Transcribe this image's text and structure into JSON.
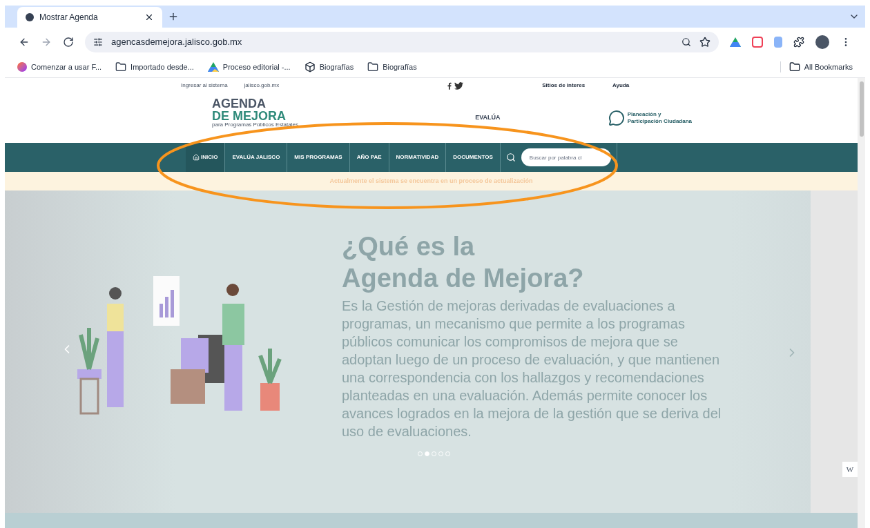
{
  "browser": {
    "tabs": [
      {
        "title": "Mostrar Agenda",
        "selected": true
      }
    ],
    "url": "agencasdemejora.jalisco.gob.mx",
    "bookmarks": [
      {
        "label": "Comenzar a usar F...",
        "kind": "firefox"
      },
      {
        "label": "Importado desde...",
        "kind": "folder"
      },
      {
        "label": "Proceso editorial -...",
        "kind": "drive"
      },
      {
        "label": "Biografías",
        "kind": "cube"
      },
      {
        "label": "Biografías",
        "kind": "folder"
      }
    ],
    "all_bookmarks": "All Bookmarks"
  },
  "topbar": {
    "links": [
      "Ingresar al sistema",
      "jalisco.gob.mx"
    ],
    "menus": [
      "Sitios de interes",
      "Ayuda"
    ]
  },
  "header": {
    "logo_line1": "AGENDA",
    "logo_line2": "DE MEJORA",
    "logo_tagline": "para Programas Públicos Estatales",
    "center_logo": "EVALÚA",
    "right_logo": [
      "Planeación y",
      "Participación Ciudadana"
    ]
  },
  "nav": {
    "items": [
      {
        "label": "INICIO",
        "kind": "home",
        "selected": true
      },
      {
        "label": "EVALÚA JALISCO",
        "kind": "plain",
        "selected": false
      },
      {
        "label": "MIS PROGRAMAS",
        "kind": "plain",
        "selected": false
      },
      {
        "label": "AÑO PAE",
        "kind": "plain",
        "selected": false
      },
      {
        "label": "NORMATIVIDAD",
        "kind": "plain",
        "selected": false
      },
      {
        "label": "DOCUMENTOS",
        "kind": "plain",
        "selected": false
      }
    ],
    "search_placeholder": "Buscar por palabra cl"
  },
  "notice": "Actualmente el sistema se encuentra en un proceso de actualización",
  "hero": {
    "title_line1": "¿Qué es la",
    "title_line2": "Agenda de Mejora?",
    "body": "Es la Gestión de mejoras derivadas de evaluaciones a programas, un mecanismo que permite a los programas públicos comunicar los compromisos de mejora que se adoptan luego de un proceso de evaluación, y que mantienen una correspondencia con los hallazgos y recomendaciones planteadas en una evaluación. Además permite conocer los avances logrados en la mejora de la gestión que se deriva del uso de evaluaciones.",
    "dots": [
      {
        "selected": false
      },
      {
        "selected": true
      },
      {
        "selected": false
      },
      {
        "selected": false
      },
      {
        "selected": false
      }
    ]
  },
  "widget": "W"
}
